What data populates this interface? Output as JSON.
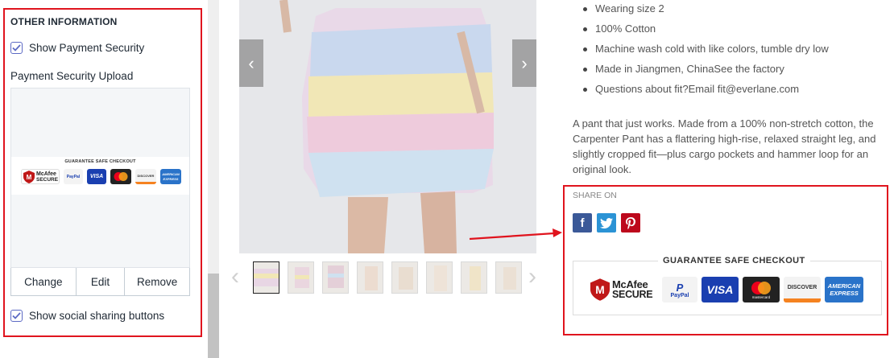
{
  "settings_panel": {
    "section_heading": "OTHER INFORMATION",
    "show_payment_security": {
      "label": "Show Payment Security",
      "checked": true
    },
    "payment_security_upload": {
      "label": "Payment Security Upload",
      "image_heading": "GUARANTEE SAFE CHECKOUT",
      "actions": [
        "Change",
        "Edit",
        "Remove"
      ]
    },
    "show_social_sharing": {
      "label": "Show social sharing buttons",
      "checked": true
    }
  },
  "product": {
    "details": [
      "Wearing size 2",
      "100% Cotton",
      "Machine wash cold with like colors, tumble dry low",
      "Made in Jiangmen, ChinaSee the factory",
      "Questions about fit?Email fit@everlane.com"
    ],
    "description": "A pant that just works. Made from a 100% non-stretch cotton, the Carpenter Pant has a flattering high-rise, relaxed straight leg, and slightly cropped fit—plus cargo pockets and hammer loop for an original look.",
    "share_label": "SHARE ON",
    "social_icons": [
      "facebook-icon",
      "twitter-icon",
      "pinterest-icon"
    ],
    "checkout_heading": "GUARANTEE SAFE CHECKOUT"
  },
  "payment_badges": {
    "mcafee_line1": "McAfee",
    "mcafee_line2": "SECURE",
    "paypal": "PayPal",
    "visa": "VISA",
    "mastercard": "mastercard",
    "discover": "DISCOVER",
    "amex_line1": "AMERICAN",
    "amex_line2": "EXPRESS"
  },
  "colors": {
    "highlight_red": "#e0141e",
    "facebook": "#3b5998",
    "twitter": "#2b93d5",
    "pinterest": "#bd081c",
    "visa_blue": "#1a3fb0"
  }
}
